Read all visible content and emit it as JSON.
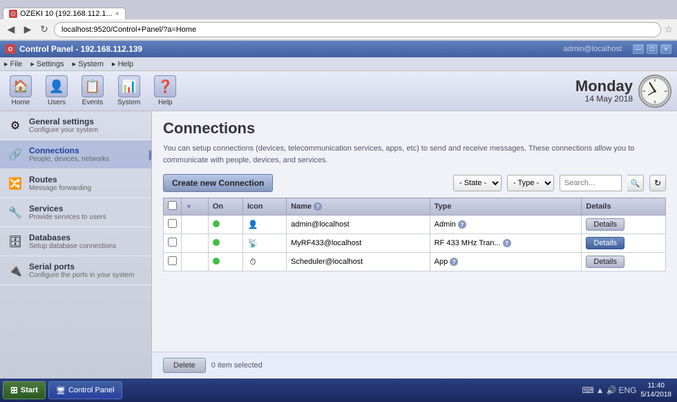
{
  "browser": {
    "tab": {
      "title": "OZEKI 10 (192.168.112.1...",
      "favicon": "O"
    },
    "address": "localhost:9520/Control+Panel/?a=Home",
    "window_controls": [
      "—",
      "□",
      "×"
    ]
  },
  "titlebar": {
    "title": "Control Panel - 192.168.112.139",
    "favicon": "O",
    "user": "admin@localhost",
    "controls": [
      "—",
      "□",
      "×"
    ]
  },
  "menubar": {
    "items": [
      "File",
      "Settings",
      "System",
      "Help"
    ]
  },
  "toolbar": {
    "buttons": [
      {
        "icon": "🏠",
        "label": "Home"
      },
      {
        "icon": "👤",
        "label": "Users"
      },
      {
        "icon": "📋",
        "label": "Events"
      },
      {
        "icon": "📊",
        "label": "System"
      },
      {
        "icon": "❓",
        "label": "Help"
      }
    ],
    "clock": {
      "day_name": "Monday",
      "date": "14 May 2018",
      "time": "11:40"
    }
  },
  "sidebar": {
    "items": [
      {
        "icon": "⚙",
        "title": "General settings",
        "subtitle": "Configure your system",
        "active": false
      },
      {
        "icon": "🔗",
        "title": "Connections",
        "subtitle": "People, devices, networks",
        "active": true
      },
      {
        "icon": "🔀",
        "title": "Routes",
        "subtitle": "Message forwarding",
        "active": false
      },
      {
        "icon": "🔧",
        "title": "Services",
        "subtitle": "Provide services to users",
        "active": false
      },
      {
        "icon": "🗄",
        "title": "Databases",
        "subtitle": "Setup database connections",
        "active": false
      },
      {
        "icon": "🔌",
        "title": "Serial ports",
        "subtitle": "Configure the ports in your system",
        "active": false
      }
    ]
  },
  "content": {
    "page_title": "Connections",
    "page_desc": "You can setup connections (devices, telecommunication services, apps, etc) to send and receive messages. These connections allow you to communicate with people, devices, and services.",
    "create_button": "Create new Connection",
    "filters": {
      "state_label": "- State -",
      "type_label": "- Type -",
      "search_placeholder": "Search..."
    },
    "table": {
      "headers": [
        "",
        "",
        "On",
        "Icon",
        "Name ⓘ",
        "Type",
        "Details"
      ],
      "rows": [
        {
          "checked": false,
          "on": true,
          "icon": "👤",
          "name": "admin@localhost",
          "type": "Admin",
          "has_help": true,
          "details_active": false
        },
        {
          "checked": false,
          "on": true,
          "icon": "📡",
          "name": "MyRF433@localhost",
          "type": "RF 433 MHz Tran...",
          "has_help": true,
          "details_active": true
        },
        {
          "checked": false,
          "on": true,
          "icon": "⏱",
          "name": "Scheduler@localhost",
          "type": "App",
          "has_help": true,
          "details_active": false
        }
      ]
    },
    "footer": {
      "delete_label": "Delete",
      "selected_count": "0 item selected"
    }
  },
  "taskbar": {
    "start_label": "Start",
    "items": [
      "Control Panel"
    ],
    "tray_time": "11:40",
    "tray_date": "5/14/2018",
    "lang": "ENG"
  }
}
